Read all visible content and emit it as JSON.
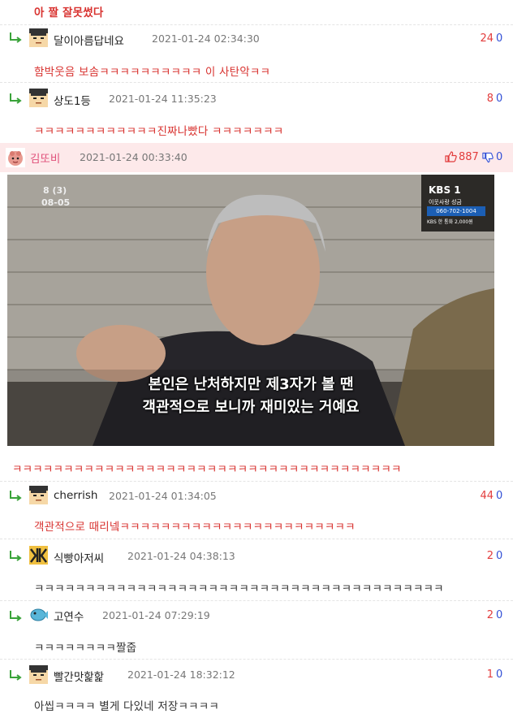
{
  "top_text": "아 짤 잘못썼다",
  "comments": [
    {
      "nick": "달이아름답네요",
      "date": "2021-01-24 02:34:30",
      "up": "24",
      "down": "0",
      "text": "함박웃음 보솜ㅋㅋㅋㅋㅋㅋㅋㅋㅋㅋ 이 사탄악ㅋㅋ"
    },
    {
      "nick": "상도1등",
      "date": "2021-01-24 11:35:23",
      "up": "8",
      "down": "0",
      "text": "ㅋㅋㅋㅋㅋㅋㅋㅋㅋㅋㅋㅋ진짜나빴다 ㅋㅋㅋㅋㅋㅋㅋ"
    },
    {
      "nick": "cherrish",
      "date": "2021-01-24 01:34:05",
      "up": "44",
      "down": "0",
      "text": "객관적으로 때리넼ㅋㅋㅋㅋㅋㅋㅋㅋㅋㅋㅋㅋㅋㅋㅋㅋㅋㅋㅋㅋㅋㅋㅋ"
    },
    {
      "nick": "식빵아저씨",
      "date": "2021-01-24 04:38:13",
      "up": "2",
      "down": "0",
      "text": "ㅋㅋㅋㅋㅋㅋㅋㅋㅋㅋㅋㅋㅋㅋㅋㅋㅋㅋㅋㅋㅋㅋㅋㅋㅋㅋㅋㅋㅋㅋㅋㅋㅋㅋㅋㅋㅋㅋㅋㅋ"
    },
    {
      "nick": "고연수",
      "date": "2021-01-24 07:29:19",
      "up": "2",
      "down": "0",
      "text": "ㅋㅋㅋㅋㅋㅋㅋㅋ짤줍"
    },
    {
      "nick": "빨간맛핥핥",
      "date": "2021-01-24 18:32:12",
      "up": "1",
      "down": "0",
      "text": "아씹ㅋㅋㅋㅋ 별게 다있네 저장ㅋㅋㅋㅋ"
    }
  ],
  "best": {
    "nick": "김또비",
    "date": "2021-01-24 00:33:40",
    "up": "887",
    "down": "0",
    "text": "ㅋㅋㅋㅋㅋㅋㅋㅋㅋㅋㅋㅋㅋㅋㅋㅋㅋㅋㅋㅋㅋㅋㅋㅋㅋㅋㅋㅋㅋㅋㅋㅋㅋㅋㅋㅋㅋㅋ",
    "image": {
      "time_top": "8 (3)",
      "time_bottom": "08-05",
      "channel": "KBS 1",
      "ch_sub1": "이웃사랑 성금",
      "ch_phone": "060-702-1004",
      "ch_sub2": "KBS 한 통화 2,000원",
      "subtitle_line1": "본인은 난처하지만 제3자가 볼 땐",
      "subtitle_line2": "객관적으로 보니까 재미있는 거예요"
    }
  },
  "colors": {
    "accent_red": "#d8322f",
    "vote_down": "#3350d6",
    "best_bg": "#fde9ea",
    "best_nick": "#e0507a"
  }
}
